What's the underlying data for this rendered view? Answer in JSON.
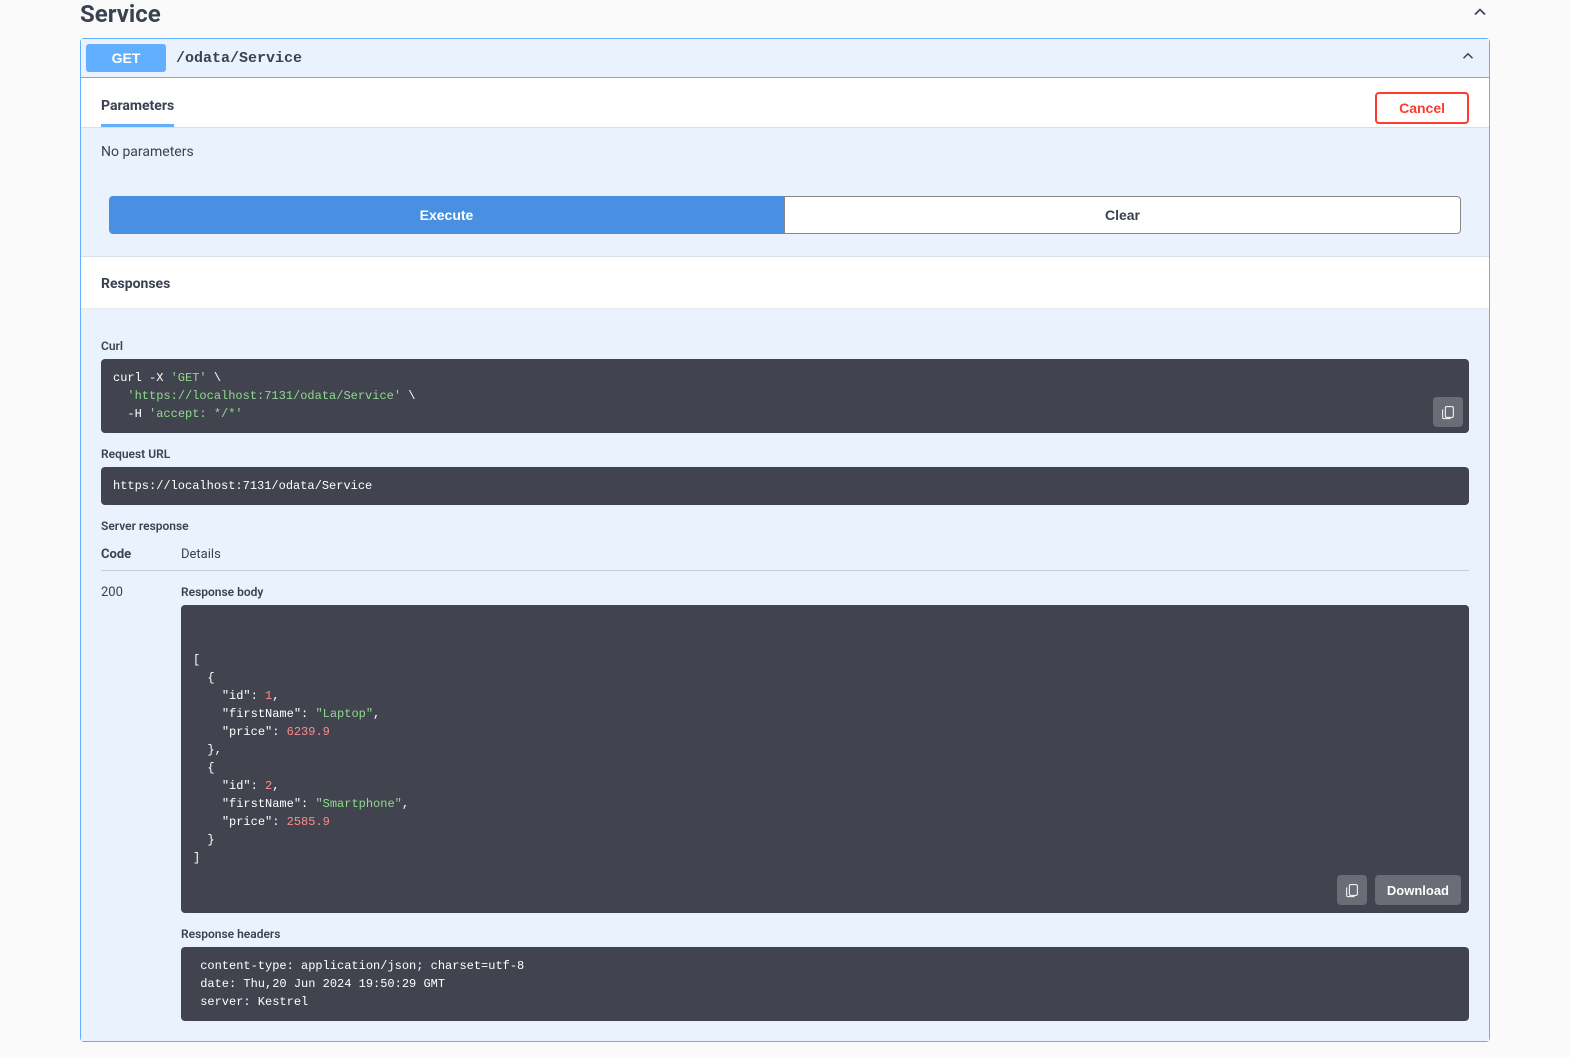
{
  "section": {
    "title": "Service"
  },
  "operation": {
    "method": "GET",
    "path": "/odata/Service"
  },
  "tabs": {
    "parameters_label": "Parameters",
    "cancel_label": "Cancel"
  },
  "parameters": {
    "empty_text": "No parameters",
    "execute_label": "Execute",
    "clear_label": "Clear"
  },
  "responses": {
    "title": "Responses",
    "curl_label": "Curl",
    "curl_cmd": {
      "prefix": "curl -X ",
      "method": "'GET'",
      "cont1": " \\",
      "url": "'https://localhost:7131/odata/Service'",
      "cont2": " \\",
      "h_flag": "  -H ",
      "accept": "'accept: */*'"
    },
    "request_url_label": "Request URL",
    "request_url": "https://localhost:7131/odata/Service",
    "server_response_label": "Server response",
    "code_header": "Code",
    "details_header": "Details",
    "status_code": "200",
    "response_body_label": "Response body",
    "body_items": [
      {
        "id": 1,
        "firstName": "Laptop",
        "price": 6239.9
      },
      {
        "id": 2,
        "firstName": "Smartphone",
        "price": 2585.9
      }
    ],
    "download_label": "Download",
    "response_headers_label": "Response headers",
    "headers_raw": " content-type: application/json; charset=utf-8 \n date: Thu,20 Jun 2024 19:50:29 GMT \n server: Kestrel "
  }
}
